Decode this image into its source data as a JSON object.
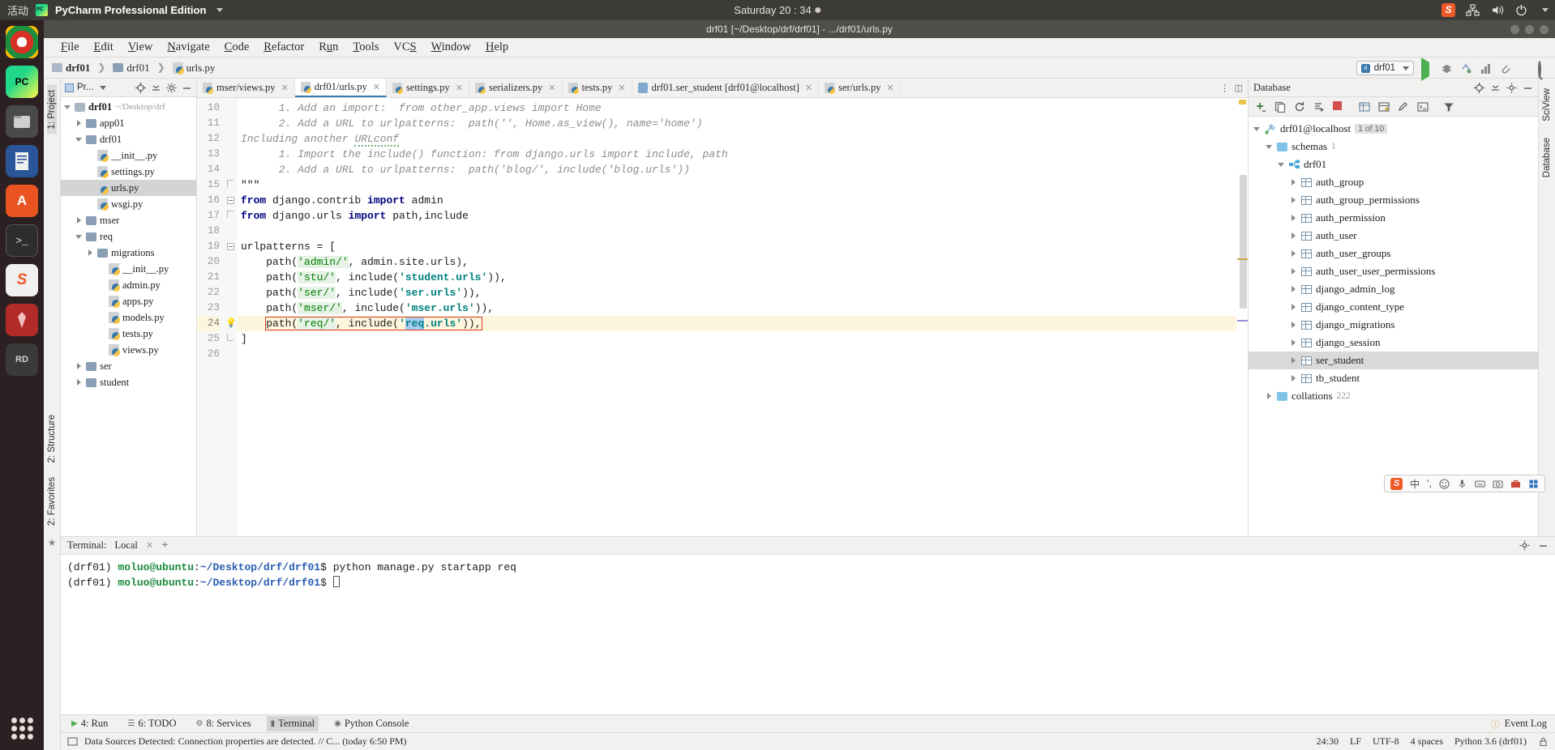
{
  "desktop": {
    "activities": "活动",
    "app_name": "PyCharm Professional Edition",
    "clock": "Saturday 20 : 34",
    "tray": [
      "sogou-icon",
      "network-icon",
      "volume-icon",
      "power-icon",
      "chevron-down-icon"
    ]
  },
  "dock": [
    {
      "name": "chrome",
      "label": ""
    },
    {
      "name": "pycharm",
      "label": "PC"
    },
    {
      "name": "files",
      "label": ""
    },
    {
      "name": "libreoffice-writer",
      "label": ""
    },
    {
      "name": "ubuntu-software",
      "label": "A"
    },
    {
      "name": "terminal",
      "label": ">_"
    },
    {
      "name": "sogou",
      "label": "S"
    },
    {
      "name": "pen-tool",
      "label": ""
    },
    {
      "name": "remote-desktop",
      "label": "RD"
    }
  ],
  "window": {
    "title": "drf01 [~/Desktop/drf/drf01] - .../drf01/urls.py"
  },
  "menubar": [
    {
      "pre": "",
      "mn": "F",
      "post": "ile"
    },
    {
      "pre": "",
      "mn": "E",
      "post": "dit"
    },
    {
      "pre": "",
      "mn": "V",
      "post": "iew"
    },
    {
      "pre": "",
      "mn": "N",
      "post": "avigate"
    },
    {
      "pre": "",
      "mn": "C",
      "post": "ode"
    },
    {
      "pre": "",
      "mn": "R",
      "post": "efactor"
    },
    {
      "pre": "R",
      "mn": "u",
      "post": "n"
    },
    {
      "pre": "",
      "mn": "T",
      "post": "ools"
    },
    {
      "pre": "VC",
      "mn": "S",
      "post": ""
    },
    {
      "pre": "",
      "mn": "W",
      "post": "indow"
    },
    {
      "pre": "",
      "mn": "H",
      "post": "elp"
    }
  ],
  "breadcrumb": {
    "items": [
      "drf01",
      "drf01",
      "urls.py"
    ]
  },
  "toolbar": {
    "run_config": "drf01",
    "icons": [
      "run-icon",
      "debug-icon",
      "coverage-icon",
      "profile-icon",
      "attach-icon",
      "stop-icon",
      "search-everywhere-icon"
    ]
  },
  "left_strips": [
    {
      "label": "1: Project",
      "selected": true
    },
    {
      "label": "2: Structure",
      "selected": false
    },
    {
      "label": "2: Favorites",
      "selected": false
    }
  ],
  "right_strips": [
    "SciView",
    "Database"
  ],
  "project_panel": {
    "title": "Pr...",
    "header_icons": [
      "target-icon",
      "collapse-all-icon",
      "gear-icon",
      "minimize-icon"
    ],
    "tree": [
      {
        "label": "drf01",
        "path": "~/Desktop/drf",
        "indent": 0,
        "arrow": "down",
        "icon": "folder",
        "bold": true,
        "selected": false
      },
      {
        "label": "app01",
        "path": "",
        "indent": 1,
        "arrow": "right",
        "icon": "module",
        "bold": false,
        "selected": false
      },
      {
        "label": "drf01",
        "path": "",
        "indent": 1,
        "arrow": "down",
        "icon": "module",
        "bold": false,
        "selected": false
      },
      {
        "label": "__init__.py",
        "path": "",
        "indent": 2,
        "arrow": "none",
        "icon": "python",
        "bold": false,
        "selected": false
      },
      {
        "label": "settings.py",
        "path": "",
        "indent": 2,
        "arrow": "none",
        "icon": "python",
        "bold": false,
        "selected": false
      },
      {
        "label": "urls.py",
        "path": "",
        "indent": 2,
        "arrow": "none",
        "icon": "python",
        "bold": false,
        "selected": true
      },
      {
        "label": "wsgi.py",
        "path": "",
        "indent": 2,
        "arrow": "none",
        "icon": "python",
        "bold": false,
        "selected": false
      },
      {
        "label": "mser",
        "path": "",
        "indent": 1,
        "arrow": "right",
        "icon": "module",
        "bold": false,
        "selected": false
      },
      {
        "label": "req",
        "path": "",
        "indent": 1,
        "arrow": "down",
        "icon": "module",
        "bold": false,
        "selected": false
      },
      {
        "label": "migrations",
        "path": "",
        "indent": 2,
        "arrow": "right",
        "icon": "module",
        "bold": false,
        "selected": false
      },
      {
        "label": "__init__.py",
        "path": "",
        "indent": 3,
        "arrow": "none",
        "icon": "python",
        "bold": false,
        "selected": false
      },
      {
        "label": "admin.py",
        "path": "",
        "indent": 3,
        "arrow": "none",
        "icon": "python",
        "bold": false,
        "selected": false
      },
      {
        "label": "apps.py",
        "path": "",
        "indent": 3,
        "arrow": "none",
        "icon": "python",
        "bold": false,
        "selected": false
      },
      {
        "label": "models.py",
        "path": "",
        "indent": 3,
        "arrow": "none",
        "icon": "python",
        "bold": false,
        "selected": false
      },
      {
        "label": "tests.py",
        "path": "",
        "indent": 3,
        "arrow": "none",
        "icon": "python",
        "bold": false,
        "selected": false
      },
      {
        "label": "views.py",
        "path": "",
        "indent": 3,
        "arrow": "none",
        "icon": "python",
        "bold": false,
        "selected": false
      },
      {
        "label": "ser",
        "path": "",
        "indent": 1,
        "arrow": "right",
        "icon": "module",
        "bold": false,
        "selected": false
      },
      {
        "label": "student",
        "path": "",
        "indent": 1,
        "arrow": "right",
        "icon": "module",
        "bold": false,
        "selected": false
      }
    ]
  },
  "editor": {
    "tabs": [
      {
        "label": "mser/views.py",
        "icon": "python-file-icon",
        "active": false
      },
      {
        "label": "drf01/urls.py",
        "icon": "python-file-icon",
        "active": true
      },
      {
        "label": "settings.py",
        "icon": "python-file-icon",
        "active": false
      },
      {
        "label": "serializers.py",
        "icon": "python-file-icon",
        "active": false
      },
      {
        "label": "tests.py",
        "icon": "python-file-icon",
        "active": false
      },
      {
        "label": "drf01.ser_student [drf01@localhost]",
        "icon": "database-table-icon",
        "active": false
      },
      {
        "label": "ser/urls.py",
        "icon": "python-file-icon",
        "active": false
      }
    ],
    "first_line_number": 10,
    "lines": [
      {
        "n": 10,
        "text": "      1. Add an import:  from other_app.views import Home",
        "style": "comment",
        "hl": false
      },
      {
        "n": 11,
        "text": "      2. Add a URL to urlpatterns:  path('', Home.as_view(), name='home')",
        "style": "comment",
        "hl": false
      },
      {
        "n": 12,
        "text": "Including another URLconf",
        "style": "comment-squiggle",
        "hl": false
      },
      {
        "n": 13,
        "text": "      1. Import the include() function: from django.urls import include, path",
        "style": "comment",
        "hl": false
      },
      {
        "n": 14,
        "text": "      2. Add a URL to urlpatterns:  path('blog/', include('blog.urls'))",
        "style": "comment",
        "hl": false
      },
      {
        "n": 15,
        "text": "\"\"\"",
        "style": "plain",
        "hl": false
      },
      {
        "n": 16,
        "text": "from django.contrib import admin",
        "style": "import1",
        "hl": false
      },
      {
        "n": 17,
        "text": "from django.urls import path,include",
        "style": "import2",
        "hl": false
      },
      {
        "n": 18,
        "text": "",
        "style": "plain",
        "hl": false
      },
      {
        "n": 19,
        "text": "urlpatterns = [",
        "style": "plain",
        "hl": false
      },
      {
        "n": 20,
        "text": "    path('admin/', admin.site.urls),",
        "style": "path-admin",
        "hl": false
      },
      {
        "n": 21,
        "text": "    path('stu/', include('student.urls')),",
        "style": "path-inc",
        "hl": false
      },
      {
        "n": 22,
        "text": "    path('ser/', include('ser.urls')),",
        "style": "path-inc",
        "hl": false
      },
      {
        "n": 23,
        "text": "    path('mser/', include('mser.urls')),",
        "style": "path-inc",
        "hl": false
      },
      {
        "n": 24,
        "text": "    path('req/', include('req.urls')),",
        "style": "path-inc-selected",
        "hl": true
      },
      {
        "n": 25,
        "text": "]",
        "style": "plain",
        "hl": false
      },
      {
        "n": 26,
        "text": "",
        "style": "plain",
        "hl": false
      }
    ],
    "highlighted_line": 24,
    "selection_text": "req",
    "bulb_icon": "intention-bulb-icon"
  },
  "database": {
    "panel_title": "Database",
    "header_icons": [
      "settings-icon",
      "collapse-icon",
      "gear-icon",
      "minimize-icon"
    ],
    "toolbar_icons": [
      "add-icon",
      "duplicate-icon",
      "refresh-icon",
      "run-query-icon",
      "stop-icon",
      "table-icon",
      "data-editor-icon",
      "edit-icon",
      "console-icon",
      "filter-icon"
    ],
    "tree": [
      {
        "label": "drf01@localhost",
        "indent": 0,
        "arrow": "down",
        "icon": "datasource-icon",
        "badge": "1 of 10",
        "count": "",
        "selected": false
      },
      {
        "label": "schemas",
        "indent": 1,
        "arrow": "down",
        "icon": "folder-icon",
        "badge": "",
        "count": "1",
        "selected": false
      },
      {
        "label": "drf01",
        "indent": 2,
        "arrow": "down",
        "icon": "schema-icon",
        "badge": "",
        "count": "",
        "selected": false
      },
      {
        "label": "auth_group",
        "indent": 3,
        "arrow": "right",
        "icon": "table-icon",
        "badge": "",
        "count": "",
        "selected": false
      },
      {
        "label": "auth_group_permissions",
        "indent": 3,
        "arrow": "right",
        "icon": "table-icon",
        "badge": "",
        "count": "",
        "selected": false
      },
      {
        "label": "auth_permission",
        "indent": 3,
        "arrow": "right",
        "icon": "table-icon",
        "badge": "",
        "count": "",
        "selected": false
      },
      {
        "label": "auth_user",
        "indent": 3,
        "arrow": "right",
        "icon": "table-icon",
        "badge": "",
        "count": "",
        "selected": false
      },
      {
        "label": "auth_user_groups",
        "indent": 3,
        "arrow": "right",
        "icon": "table-icon",
        "badge": "",
        "count": "",
        "selected": false
      },
      {
        "label": "auth_user_user_permissions",
        "indent": 3,
        "arrow": "right",
        "icon": "table-icon",
        "badge": "",
        "count": "",
        "selected": false
      },
      {
        "label": "django_admin_log",
        "indent": 3,
        "arrow": "right",
        "icon": "table-icon",
        "badge": "",
        "count": "",
        "selected": false
      },
      {
        "label": "django_content_type",
        "indent": 3,
        "arrow": "right",
        "icon": "table-icon",
        "badge": "",
        "count": "",
        "selected": false
      },
      {
        "label": "django_migrations",
        "indent": 3,
        "arrow": "right",
        "icon": "table-icon",
        "badge": "",
        "count": "",
        "selected": false
      },
      {
        "label": "django_session",
        "indent": 3,
        "arrow": "right",
        "icon": "table-icon",
        "badge": "",
        "count": "",
        "selected": false
      },
      {
        "label": "ser_student",
        "indent": 3,
        "arrow": "right",
        "icon": "table-icon",
        "badge": "",
        "count": "",
        "selected": true
      },
      {
        "label": "tb_student",
        "indent": 3,
        "arrow": "right",
        "icon": "table-icon",
        "badge": "",
        "count": "",
        "selected": false
      },
      {
        "label": "collations",
        "indent": 1,
        "arrow": "right",
        "icon": "folder-icon",
        "badge": "",
        "count": "222",
        "selected": false
      }
    ]
  },
  "terminal": {
    "title": "Terminal:",
    "tab": "Local",
    "lines": [
      {
        "env": "(drf01) ",
        "user": "moluo",
        "at": "@",
        "host": "ubuntu",
        "colon": ":",
        "path": "~/Desktop/drf/drf01",
        "prompt": "$ ",
        "cmd": "python manage.py startapp req",
        "cursor": false
      },
      {
        "env": "(drf01) ",
        "user": "moluo",
        "at": "@",
        "host": "ubuntu",
        "colon": ":",
        "path": "~/Desktop/drf/drf01",
        "prompt": "$ ",
        "cmd": "",
        "cursor": true
      }
    ]
  },
  "sogou_bar": {
    "logo": "S",
    "items": [
      "中",
      "comma-icon",
      "emoji-icon",
      "mic-icon",
      "keyboard-icon",
      "screenshot-icon",
      "toolbox-icon",
      "menu-icon"
    ]
  },
  "bottom_tabs": [
    {
      "label": "4: Run",
      "icon": "run-icon",
      "selected": false
    },
    {
      "label": "6: TODO",
      "icon": "todo-icon",
      "selected": false
    },
    {
      "label": "8: Services",
      "icon": "services-icon",
      "selected": false
    },
    {
      "label": "Terminal",
      "icon": "terminal-icon",
      "selected": true
    },
    {
      "label": "Python Console",
      "icon": "python-console-icon",
      "selected": false
    }
  ],
  "event_log": "Event Log",
  "statusbar": {
    "message": "Data Sources Detected: Connection properties are detected. // C... (today 6:50 PM)",
    "caret": "24:30",
    "line_sep": "LF",
    "encoding": "UTF-8",
    "indent": "4 spaces",
    "interpreter": "Python 3.6 (drf01)",
    "lock_icon": "lock-icon"
  }
}
